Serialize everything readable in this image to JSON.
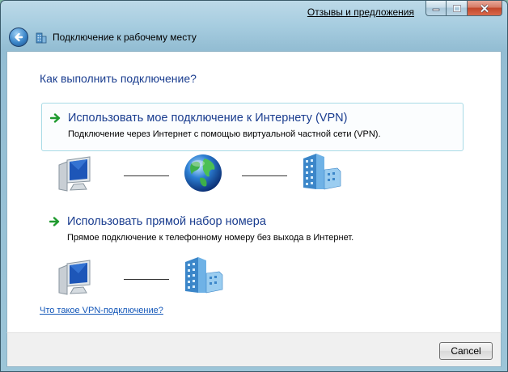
{
  "titlebar": {
    "feedback_link": "Отзывы и предложения"
  },
  "navbar": {
    "title": "Подключение к рабочему месту"
  },
  "content": {
    "question": "Как выполнить подключение?",
    "options": [
      {
        "title": "Использовать мое подключение к Интернету (VPN)",
        "description": "Подключение через Интернет с помощью виртуальной частной сети (VPN)."
      },
      {
        "title": "Использовать прямой набор номера",
        "description": "Прямое подключение к телефонному номеру без выхода в Интернет."
      }
    ],
    "help_link": "Что такое VPN-подключение?"
  },
  "footer": {
    "cancel_label": "Cancel"
  },
  "colors": {
    "heading_blue": "#1a3d8f",
    "link_blue": "#1256b8",
    "arrow_green": "#1f9a2e",
    "highlight_border": "#a8dbe6"
  },
  "icons": [
    "back-arrow-icon",
    "network-folder-icon",
    "green-arrow-icon",
    "computer-icon",
    "globe-icon",
    "office-building-icon"
  ]
}
